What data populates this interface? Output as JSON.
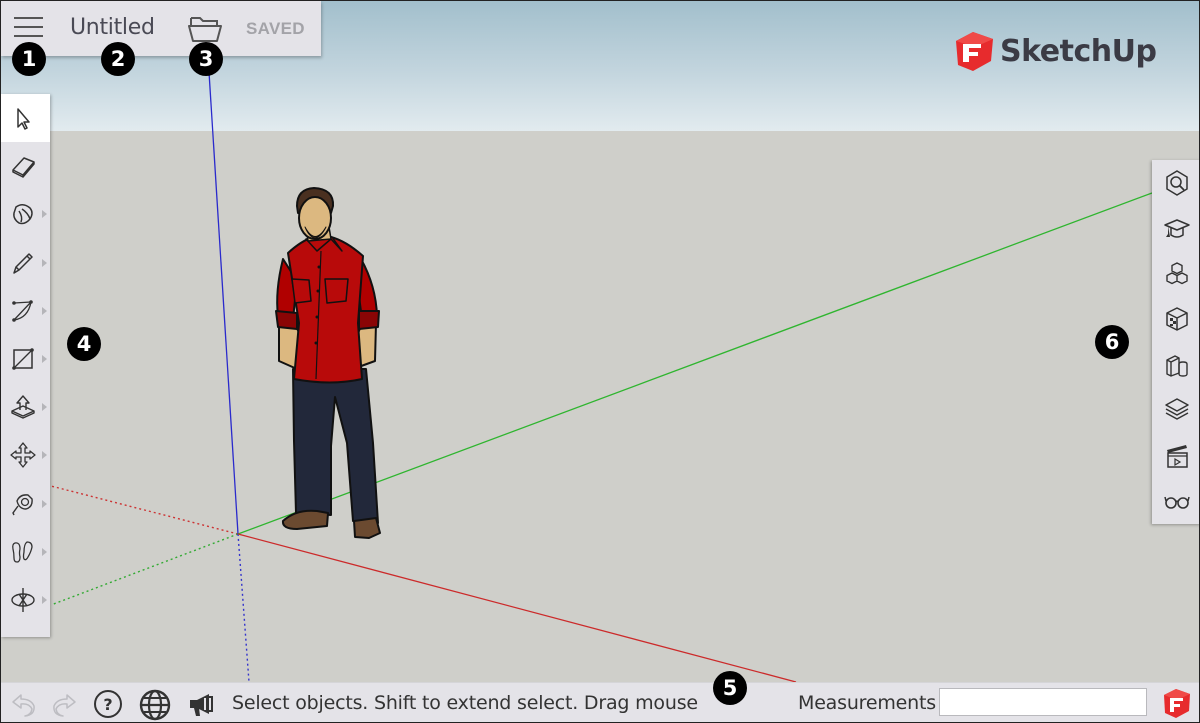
{
  "app": {
    "name": "SketchUp",
    "brand_color": "#e72b2d"
  },
  "titlebar": {
    "menu_icon": "hamburger-menu-icon",
    "document_title": "Untitled",
    "open_icon": "folder-open-icon",
    "save_status": "SAVED"
  },
  "logo": {
    "text": "SketchUp",
    "icon": "sketchup-logo-icon"
  },
  "left_toolbar": {
    "tools": [
      {
        "name": "select",
        "icon": "select-arrow-icon",
        "active": true,
        "has_flyout": false
      },
      {
        "name": "eraser",
        "icon": "eraser-icon",
        "active": false,
        "has_flyout": false
      },
      {
        "name": "paint",
        "icon": "paint-bucket-icon",
        "active": false,
        "has_flyout": true
      },
      {
        "name": "pencil",
        "icon": "pencil-icon",
        "active": false,
        "has_flyout": true
      },
      {
        "name": "arc",
        "icon": "arc-icon",
        "active": false,
        "has_flyout": true
      },
      {
        "name": "rectangle",
        "icon": "rectangle-icon",
        "active": false,
        "has_flyout": true
      },
      {
        "name": "push-pull",
        "icon": "push-pull-icon",
        "active": false,
        "has_flyout": true
      },
      {
        "name": "move",
        "icon": "move-icon",
        "active": false,
        "has_flyout": true
      },
      {
        "name": "tape-measure",
        "icon": "tape-measure-icon",
        "active": false,
        "has_flyout": true
      },
      {
        "name": "walk",
        "icon": "footprints-icon",
        "active": false,
        "has_flyout": true
      },
      {
        "name": "orbit",
        "icon": "orbit-icon",
        "active": false,
        "has_flyout": true
      }
    ]
  },
  "right_panel": {
    "buttons": [
      {
        "name": "entity-info",
        "icon": "entity-info-icon"
      },
      {
        "name": "instructor",
        "icon": "graduation-cap-icon"
      },
      {
        "name": "components",
        "icon": "components-icon"
      },
      {
        "name": "materials",
        "icon": "materials-cube-icon"
      },
      {
        "name": "styles",
        "icon": "styles-icon"
      },
      {
        "name": "layers",
        "icon": "layers-icon"
      },
      {
        "name": "scenes",
        "icon": "clapperboard-icon"
      },
      {
        "name": "display",
        "icon": "glasses-icon"
      }
    ]
  },
  "statusbar": {
    "undo_icon": "undo-icon",
    "redo_icon": "redo-icon",
    "help_icon": "help-circle-icon",
    "language_icon": "globe-icon",
    "announcement_icon": "megaphone-icon",
    "status_text": "Select objects. Shift to extend select. Drag mouse",
    "measurements_label": "Measurements",
    "measurements_value": "",
    "trimble_icon": "sketchup-logo-icon"
  },
  "callouts": [
    "1",
    "2",
    "3",
    "4",
    "5",
    "6"
  ],
  "scene": {
    "axis_colors": {
      "red": "#cc2a2a",
      "green": "#2fb52f",
      "blue": "#2a2acc"
    },
    "figure": "standing-man-red-shirt"
  }
}
